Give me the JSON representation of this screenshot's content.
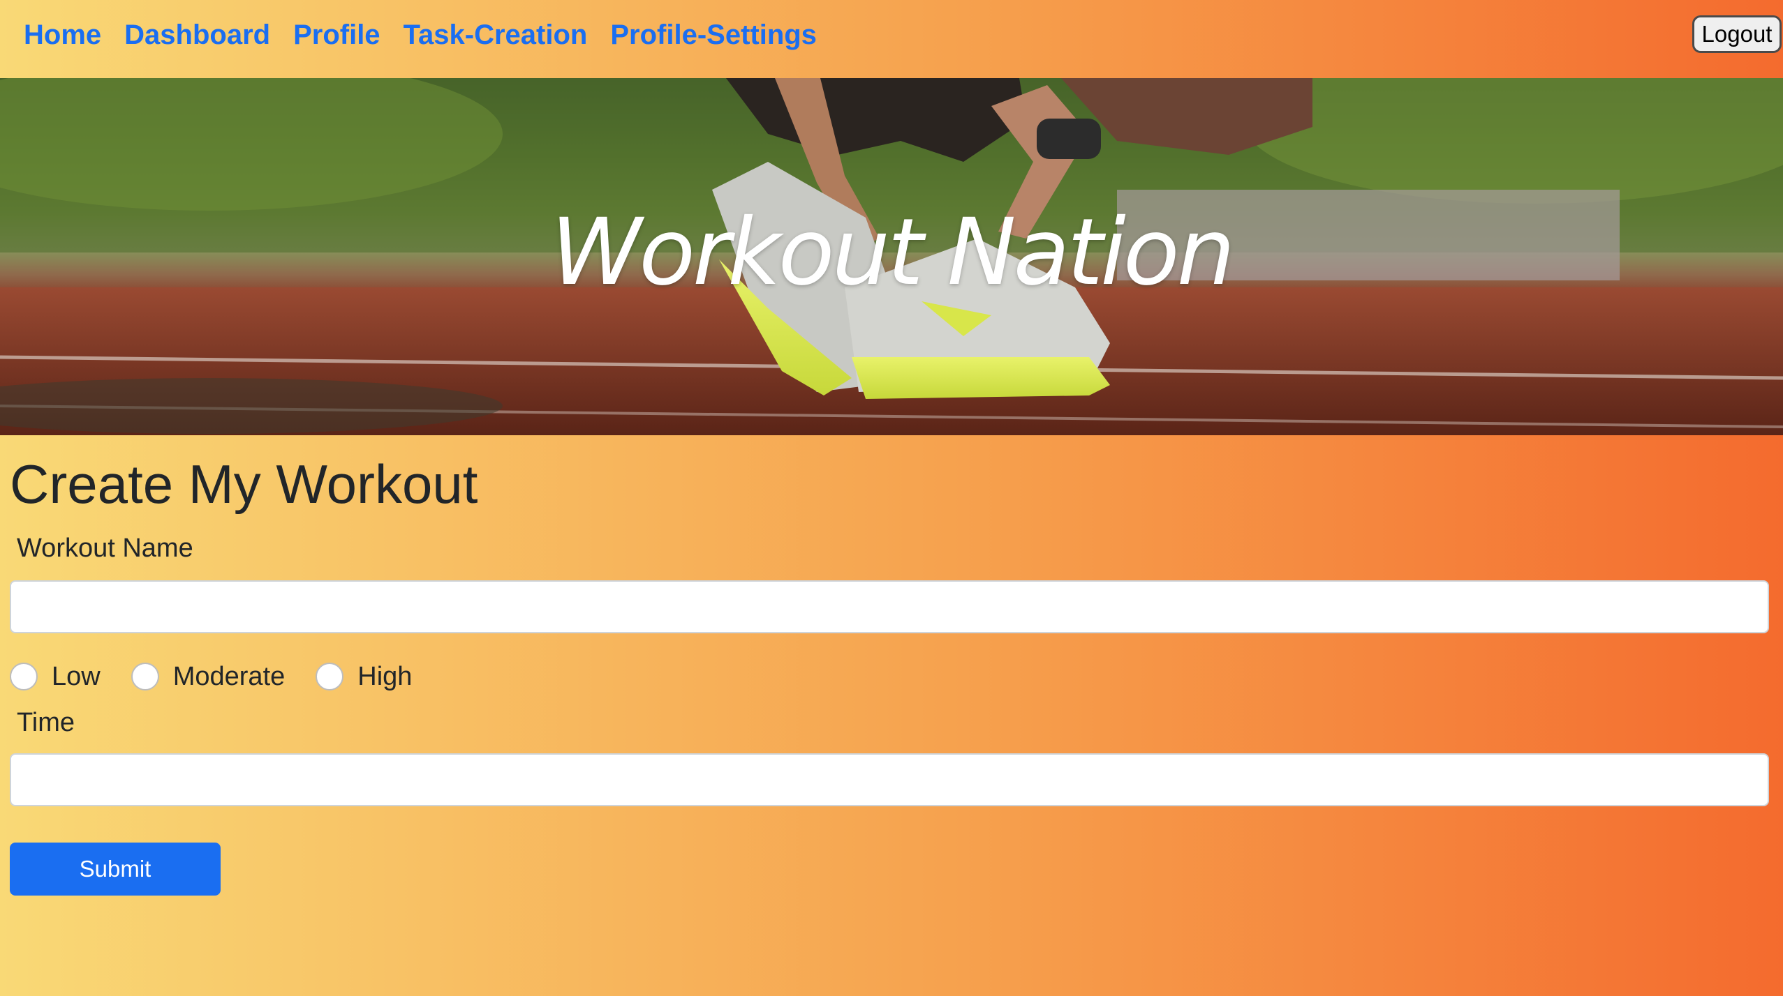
{
  "nav": {
    "links": [
      {
        "label": "Home"
      },
      {
        "label": "Dashboard"
      },
      {
        "label": "Profile"
      },
      {
        "label": "Task-Creation"
      },
      {
        "label": "Profile-Settings"
      }
    ],
    "logout_label": "Logout",
    "link_color": "#1a6ef1"
  },
  "hero": {
    "title": "Workout Nation",
    "image_subject": "runner tying shoe on running track"
  },
  "form": {
    "heading": "Create My Workout",
    "workout_name_label": "Workout Name",
    "workout_name_value": "",
    "intensity_options": [
      {
        "label": "Low",
        "checked": false
      },
      {
        "label": "Moderate",
        "checked": false
      },
      {
        "label": "High",
        "checked": false
      }
    ],
    "time_label": "Time",
    "time_value": "",
    "submit_label": "Submit"
  },
  "colors": {
    "background_gradient": [
      "#f9d976",
      "#f6a04d",
      "#f46b2e"
    ],
    "primary": "#1a6ef1"
  }
}
